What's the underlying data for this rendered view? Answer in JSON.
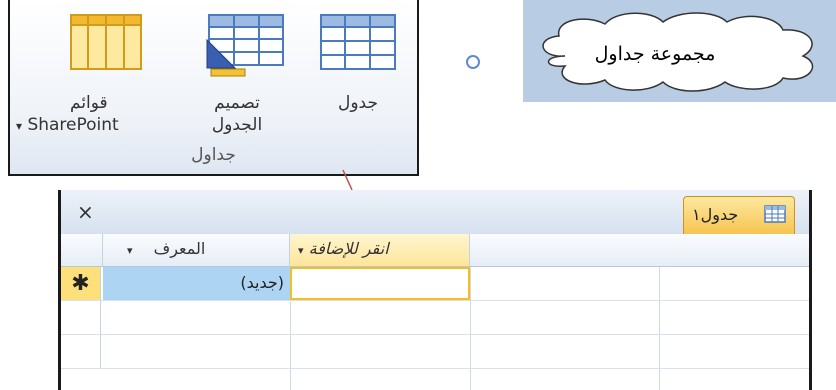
{
  "ribbon": {
    "buttons": [
      {
        "id": "table",
        "label": "جدول",
        "icon": "table-icon"
      },
      {
        "id": "table-design",
        "label_line1": "تصميم",
        "label_line2": "الجدول",
        "icon": "table-design-icon"
      },
      {
        "id": "sharepoint-lists",
        "label_line1": "قوائم",
        "label_line2": "SharePoint",
        "dropdown_arrow": "▾",
        "icon": "sharepoint-list-icon"
      }
    ],
    "group_label": "جداول"
  },
  "callout": {
    "text": "مجموعة جداول",
    "background": "#b8cce4"
  },
  "datasheet": {
    "tab_title": "جدول١",
    "close_symbol": "×",
    "columns": {
      "id_header": "المعرف",
      "add_header": "انقر للإضافة",
      "sort_arrow": "▾"
    },
    "new_row": {
      "selector_symbol": "✱",
      "id_value": "(جديد)"
    }
  },
  "colors": {
    "accent": "#f6c34d",
    "selection": "#aed4f3",
    "border": "#1a1a1a"
  }
}
